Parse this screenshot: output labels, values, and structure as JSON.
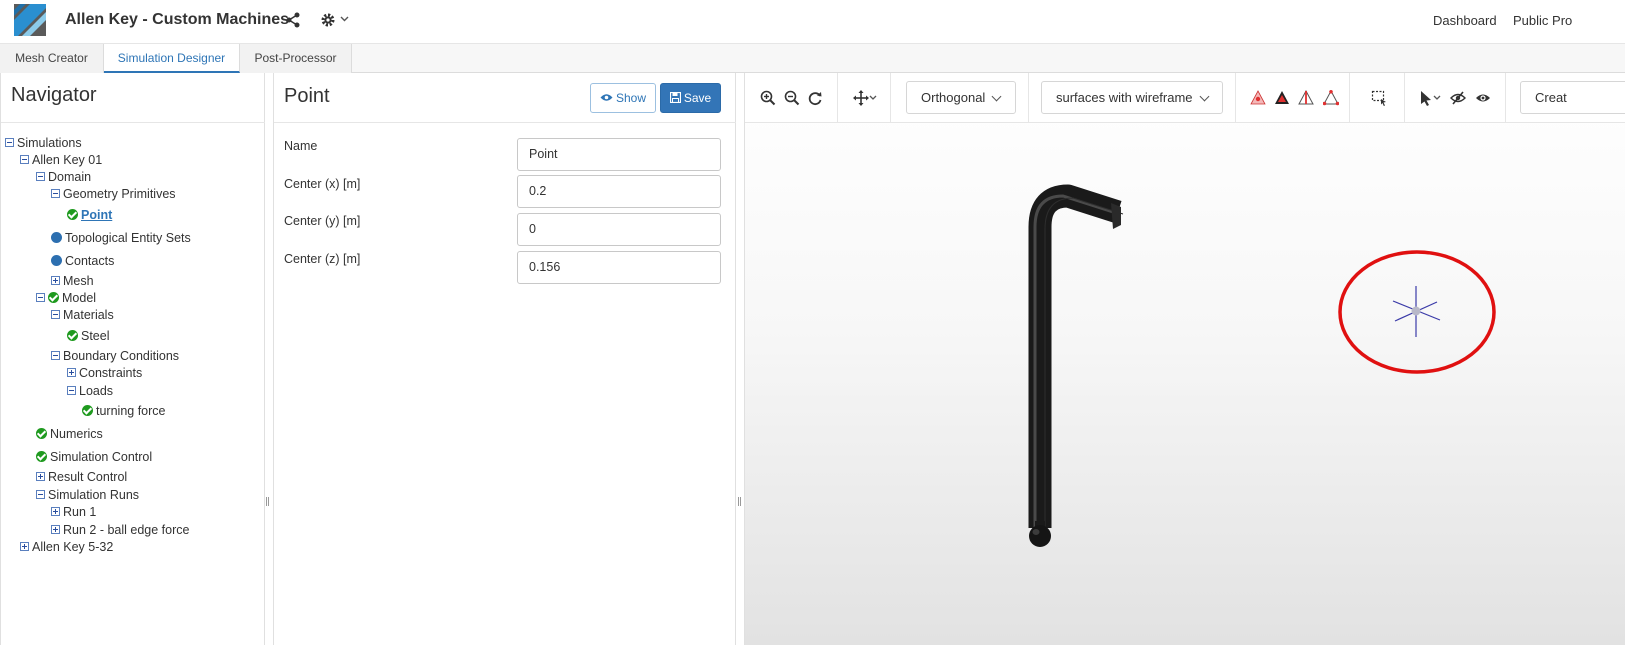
{
  "header": {
    "title": "Allen Key - Custom Machines",
    "links": [
      "Dashboard",
      "Public Pro"
    ]
  },
  "tabs": [
    {
      "label": "Mesh Creator",
      "active": false
    },
    {
      "label": "Simulation Designer",
      "active": true
    },
    {
      "label": "Post-Processor",
      "active": false
    }
  ],
  "navigator": {
    "title": "Navigator",
    "tree": [
      {
        "label": "Simulations",
        "icon": "minus-box"
      },
      {
        "label": "Allen Key 01",
        "icon": "minus-box"
      },
      {
        "label": "Domain",
        "icon": "minus-box"
      },
      {
        "label": "Geometry Primitives",
        "icon": "minus-box"
      },
      {
        "label": "Point",
        "icon": "check-icon",
        "selected": true
      },
      {
        "label": "Topological Entity Sets",
        "icon": "dot-icon"
      },
      {
        "label": "Contacts",
        "icon": "dot-icon"
      },
      {
        "label": "Mesh",
        "icon": "plus-box"
      },
      {
        "label": "Model",
        "icon": "minus-box+check-icon"
      },
      {
        "label": "Materials",
        "icon": "minus-box"
      },
      {
        "label": "Steel",
        "icon": "check-icon"
      },
      {
        "label": "Boundary Conditions",
        "icon": "minus-box"
      },
      {
        "label": "Constraints",
        "icon": "plus-box"
      },
      {
        "label": "Loads",
        "icon": "minus-box"
      },
      {
        "label": "turning force",
        "icon": "check-icon"
      },
      {
        "label": "Numerics",
        "icon": "check-icon"
      },
      {
        "label": "Simulation Control",
        "icon": "check-icon"
      },
      {
        "label": "Result Control",
        "icon": "plus-box"
      },
      {
        "label": "Simulation Runs",
        "icon": "minus-box"
      },
      {
        "label": "Run 1",
        "icon": "plus-box"
      },
      {
        "label": "Run 2 - ball edge force",
        "icon": "plus-box"
      },
      {
        "label": "Allen Key 5-32",
        "icon": "plus-box"
      }
    ]
  },
  "panel": {
    "title": "Point",
    "show_label": "Show",
    "save_label": "Save",
    "fields": [
      {
        "label": "Name",
        "value": "Point"
      },
      {
        "label": "Center (x) [m]",
        "value": "0.2"
      },
      {
        "label": "Center (y) [m]",
        "value": "0"
      },
      {
        "label": "Center (z) [m]",
        "value": "0.156"
      }
    ]
  },
  "viewer": {
    "projection": "Orthogonal",
    "render_mode": "surfaces with wireframe",
    "create_label": "Creat",
    "accent_color": "#3375b7",
    "highlight_color": "#e01010"
  }
}
